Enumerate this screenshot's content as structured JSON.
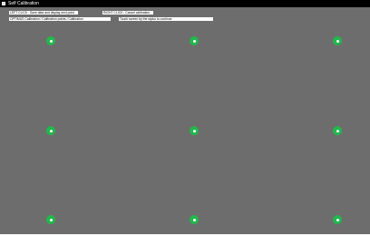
{
  "window": {
    "title": "Self Calibration"
  },
  "hints": {
    "left_click": "LEFT CLICK : Save data and display next point",
    "right_click": "RIGHT CLICK : Cancel calibration",
    "help_text": "OPTIMUS Calibration / Calibration points / Calibration",
    "hint_text": "Touch screen by the stylus to continue"
  },
  "targets": [
    {
      "id": "top-left"
    },
    {
      "id": "top-center"
    },
    {
      "id": "top-right"
    },
    {
      "id": "middle-left"
    },
    {
      "id": "middle-center"
    },
    {
      "id": "middle-right"
    },
    {
      "id": "bottom-left"
    },
    {
      "id": "bottom-center"
    },
    {
      "id": "bottom-right"
    }
  ],
  "colors": {
    "background": "#6d6d6d",
    "target": "#21b84c",
    "target_center": "#ffffff"
  }
}
